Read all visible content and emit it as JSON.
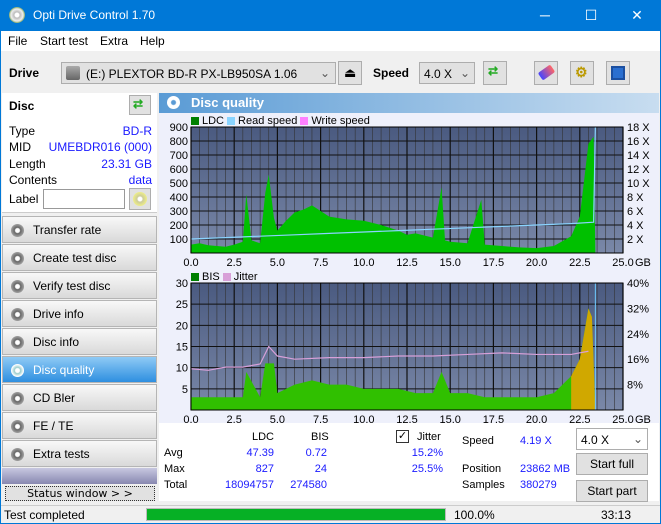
{
  "window": {
    "title": "Opti Drive Control 1.70",
    "minimize": "─",
    "maximize": "☐",
    "close": "✕"
  },
  "menu": [
    {
      "label": "File"
    },
    {
      "label": "Start test"
    },
    {
      "label": "Extra"
    },
    {
      "label": "Help"
    }
  ],
  "toolbar": {
    "drive_label": "Drive",
    "drive_value": "(E:)  PLEXTOR BD-R  PX-LB950SA 1.06",
    "speed_label": "Speed",
    "speed_value": "4.0 X"
  },
  "disc": {
    "title": "Disc",
    "type_label": "Type",
    "type": "BD-R",
    "mid_label": "MID",
    "mid": "UMEBDR016 (000)",
    "length_label": "Length",
    "length": "23.31 GB",
    "contents_label": "Contents",
    "contents": "data",
    "label_label": "Label",
    "label_value": ""
  },
  "nav": [
    {
      "label": "Transfer rate"
    },
    {
      "label": "Create test disc"
    },
    {
      "label": "Verify test disc"
    },
    {
      "label": "Drive info"
    },
    {
      "label": "Disc info"
    },
    {
      "label": "Disc quality",
      "active": true
    },
    {
      "label": "CD Bler"
    },
    {
      "label": "FE / TE"
    },
    {
      "label": "Extra tests"
    }
  ],
  "status_window_btn": "Status window > >",
  "panel_title": "Disc quality",
  "chart_data": [
    {
      "type": "area",
      "title": "LDC / Read speed",
      "legend": [
        "LDC",
        "Read speed",
        "Write speed"
      ],
      "legend_colors": [
        "#00b000",
        "#6ecbff",
        "#ff80ff"
      ],
      "xlabel": "GB",
      "xlim": [
        0,
        25
      ],
      "x_ticks": [
        "0.0",
        "2.5",
        "5.0",
        "7.5",
        "10.0",
        "12.5",
        "15.0",
        "17.5",
        "20.0",
        "22.5",
        "25.0"
      ],
      "ylim": [
        0,
        900
      ],
      "y_ticks": [
        "100",
        "200",
        "300",
        "400",
        "500",
        "600",
        "700",
        "800",
        "900"
      ],
      "y2lim": [
        0,
        18
      ],
      "y2_ticks": [
        "2 X",
        "4 X",
        "6 X",
        "8 X",
        "10 X",
        "12 X",
        "14 X",
        "16 X",
        "18 X"
      ],
      "series": [
        {
          "name": "LDC",
          "x": [
            0,
            0.5,
            1,
            1.5,
            2,
            2.5,
            3,
            3.2,
            3.5,
            4,
            4.3,
            4.5,
            4.8,
            5,
            5.5,
            6,
            6.5,
            7,
            7.5,
            8,
            9,
            10,
            11,
            12,
            12.5,
            13,
            14,
            14.5,
            14.7,
            15,
            16,
            16.8,
            17,
            18,
            19,
            20,
            21,
            22,
            22.5,
            23,
            23.3,
            23.4
          ],
          "y": [
            60,
            70,
            55,
            50,
            45,
            60,
            80,
            420,
            90,
            70,
            430,
            560,
            250,
            160,
            230,
            290,
            310,
            340,
            300,
            260,
            240,
            230,
            200,
            160,
            130,
            140,
            110,
            470,
            90,
            80,
            70,
            380,
            60,
            50,
            40,
            35,
            50,
            120,
            260,
            780,
            830,
            0
          ]
        },
        {
          "name": "Read speed",
          "x": [
            0,
            2,
            4,
            6,
            8,
            10,
            12,
            14,
            16,
            18,
            20,
            22,
            23.3,
            23.4
          ],
          "y": [
            2,
            2.2,
            2.4,
            2.6,
            2.8,
            3.0,
            3.2,
            3.4,
            3.6,
            3.8,
            4.0,
            4.2,
            4.4,
            18
          ]
        }
      ]
    },
    {
      "type": "area",
      "title": "BIS / Jitter",
      "legend": [
        "BIS",
        "Jitter"
      ],
      "legend_colors": [
        "#00b000",
        "#d8a0d8"
      ],
      "xlabel": "GB",
      "xlim": [
        0,
        25
      ],
      "x_ticks": [
        "0.0",
        "2.5",
        "5.0",
        "7.5",
        "10.0",
        "12.5",
        "15.0",
        "17.5",
        "20.0",
        "22.5",
        "25.0"
      ],
      "ylim": [
        0,
        30
      ],
      "y_ticks": [
        "5",
        "10",
        "15",
        "20",
        "25",
        "30"
      ],
      "y2lim": [
        0,
        40
      ],
      "y2_ticks": [
        "8%",
        "16%",
        "24%",
        "32%",
        "40%"
      ],
      "series": [
        {
          "name": "BIS",
          "x": [
            0,
            1,
            2,
            3,
            3.2,
            4,
            4.3,
            4.8,
            5,
            6,
            7,
            8,
            9,
            10,
            11,
            12,
            13,
            14,
            14.5,
            15,
            16,
            17,
            18,
            19,
            20,
            21,
            22,
            22.5,
            23,
            23.2,
            23.4
          ],
          "y": [
            3,
            3,
            3,
            3,
            9,
            3,
            11,
            11,
            4,
            6,
            7,
            6,
            6,
            5,
            5,
            5,
            4,
            4,
            9,
            4,
            4,
            3,
            3,
            3,
            3,
            4,
            8,
            12,
            24,
            22,
            0
          ]
        },
        {
          "name": "Jitter",
          "x": [
            0,
            1,
            2,
            3,
            4,
            4.5,
            5,
            6,
            8,
            10,
            12,
            14,
            16,
            18,
            20,
            22,
            23
          ],
          "y": [
            13,
            12.5,
            13.5,
            13.5,
            14.5,
            20,
            17,
            16,
            16.5,
            16.5,
            17,
            17,
            17.5,
            18,
            17.5,
            17.5,
            18.5
          ]
        }
      ]
    }
  ],
  "stats": {
    "col_ldc": "LDC",
    "col_bis": "BIS",
    "jitter_label": "Jitter",
    "jitter_checked": true,
    "avg_label": "Avg",
    "avg_ldc": "47.39",
    "avg_bis": "0.72",
    "avg_jitter": "15.2%",
    "max_label": "Max",
    "max_ldc": "827",
    "max_bis": "24",
    "max_jitter": "25.5%",
    "total_label": "Total",
    "total_ldc": "18094757",
    "total_bis": "274580",
    "speed_label": "Speed",
    "speed": "4.19 X",
    "position_label": "Position",
    "position": "23862 MB",
    "samples_label": "Samples",
    "samples": "380279",
    "speed_select": "4.0 X",
    "start_full": "Start full",
    "start_part": "Start part"
  },
  "status": {
    "text": "Test completed",
    "progress": 1.0,
    "progress_text": "100.0%",
    "elapsed": "33:13"
  }
}
